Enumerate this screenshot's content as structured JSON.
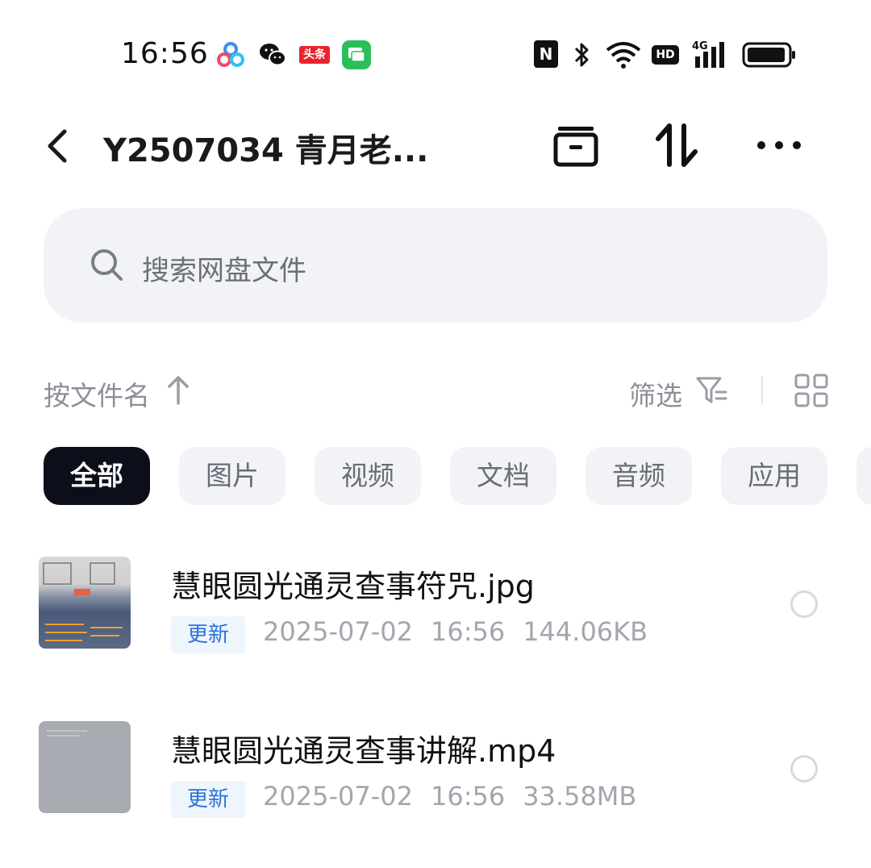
{
  "status_bar": {
    "time": "16:56",
    "apps": [
      "baidu-netdisk-icon",
      "wechat-icon",
      "toutiao-icon",
      "messages-icon"
    ],
    "toutiao_label": "头条",
    "nfc_label": "N",
    "hd_label": "HD",
    "signal_label": "4G"
  },
  "header": {
    "title": "Y2507034 青月老..."
  },
  "search": {
    "placeholder": "搜索网盘文件"
  },
  "toolbar": {
    "sort_label": "按文件名",
    "filter_label": "筛选"
  },
  "chips": [
    {
      "label": "全部",
      "active": true
    },
    {
      "label": "图片",
      "active": false
    },
    {
      "label": "视频",
      "active": false
    },
    {
      "label": "文档",
      "active": false
    },
    {
      "label": "音频",
      "active": false
    },
    {
      "label": "应用",
      "active": false
    }
  ],
  "files": [
    {
      "name": "慧眼圆光通灵查事符咒.jpg",
      "badge": "更新",
      "date": "2025-07-02",
      "time": "16:56",
      "size": "144.06KB",
      "type": "image"
    },
    {
      "name": "慧眼圆光通灵查事讲解.mp4",
      "badge": "更新",
      "date": "2025-07-02",
      "time": "16:56",
      "size": "33.58MB",
      "type": "video"
    }
  ],
  "colors": {
    "accent_blue": "#2a73d9",
    "chip_active_bg": "#0c0f1a",
    "chip_bg": "#f2f3f7"
  }
}
